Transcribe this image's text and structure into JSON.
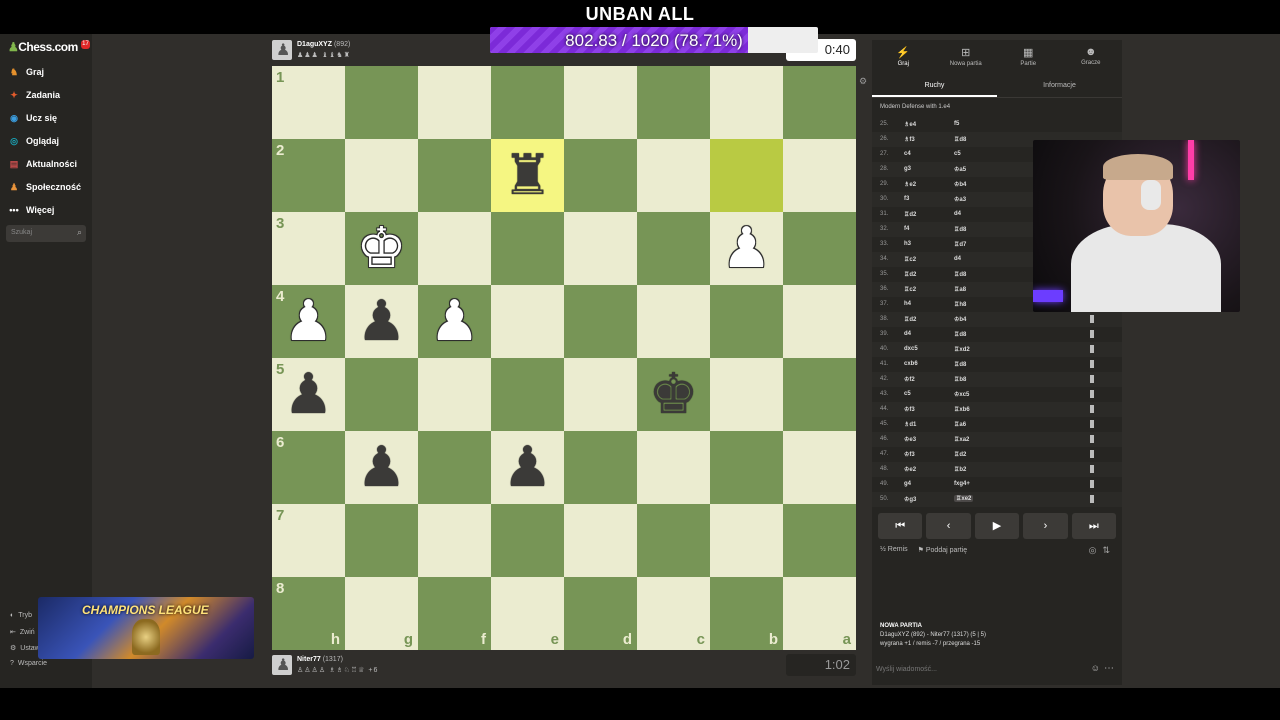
{
  "overlay": {
    "title": "UNBAN ALL",
    "goal_text": "802.83 / 1020 (78.71%)",
    "goal_progress": 0.7871,
    "accent": "#7c2ad8"
  },
  "sidebar": {
    "logo": "Chess.com",
    "notif_count": "17",
    "items": [
      {
        "label": "Graj",
        "icon": "play-icon",
        "color": "#e6912c"
      },
      {
        "label": "Zadania",
        "icon": "puzzle-icon",
        "color": "#e25b2c"
      },
      {
        "label": "Ucz się",
        "icon": "learn-icon",
        "color": "#3b9ee0"
      },
      {
        "label": "Oglądaj",
        "icon": "watch-icon",
        "color": "#1aa3b5"
      },
      {
        "label": "Aktualności",
        "icon": "news-icon",
        "color": "#c74d4d"
      },
      {
        "label": "Społeczność",
        "icon": "community-icon",
        "color": "#e8933b"
      },
      {
        "label": "Więcej",
        "icon": "more-icon",
        "color": "#ffffff"
      }
    ],
    "search_placeholder": "Szukaj",
    "bottom": [
      "Tryb",
      "Zwiń",
      "Ustaw",
      "Wsparcie"
    ]
  },
  "overlays": {
    "champions_label": "CHAMPIONS LEAGUE"
  },
  "top_player": {
    "name": "D1aguXYZ",
    "rating": "(892)",
    "captured": "♟♟♟ ♝♝♞♜",
    "clock": "0:40"
  },
  "bottom_player": {
    "name": "Niter77",
    "rating": "(1317)",
    "captured": "♙♙♙♙ ♗♗♘♖♕  +6",
    "clock": "1:02"
  },
  "board": {
    "ranks": [
      "1",
      "2",
      "3",
      "4",
      "5",
      "6",
      "7",
      "8"
    ],
    "files": [
      "h",
      "g",
      "f",
      "e",
      "d",
      "c",
      "b",
      "a"
    ],
    "highlight": [
      "2-3",
      "2-6"
    ],
    "pieces": [
      {
        "sq": "2-3",
        "glyph": "♜",
        "color": "black"
      },
      {
        "sq": "3-1",
        "glyph": "♚",
        "color": "white"
      },
      {
        "sq": "3-6",
        "glyph": "♟",
        "color": "white"
      },
      {
        "sq": "4-0",
        "glyph": "♟",
        "color": "white"
      },
      {
        "sq": "4-1",
        "glyph": "♟",
        "color": "black"
      },
      {
        "sq": "4-2",
        "glyph": "♟",
        "color": "white"
      },
      {
        "sq": "5-0",
        "glyph": "♟",
        "color": "black"
      },
      {
        "sq": "5-5",
        "glyph": "♚",
        "color": "black"
      },
      {
        "sq": "6-1",
        "glyph": "♟",
        "color": "black"
      },
      {
        "sq": "6-3",
        "glyph": "♟",
        "color": "black"
      }
    ]
  },
  "panel": {
    "tabs": [
      {
        "label": "Graj",
        "icon": "⚡",
        "active": true
      },
      {
        "label": "Nowa partia",
        "icon": "＋",
        "active": false
      },
      {
        "label": "Partie",
        "icon": "▦",
        "active": false
      },
      {
        "label": "Gracze",
        "icon": "👥",
        "active": false
      }
    ],
    "subtabs": [
      "Ruchy",
      "Informacje"
    ],
    "opening": "Modern Defense with 1.e4",
    "moves": [
      {
        "n": "25.",
        "w": "♗e4",
        "b": "f5"
      },
      {
        "n": "26.",
        "w": "♗f3",
        "b": "♖d8"
      },
      {
        "n": "27.",
        "w": "c4",
        "b": "c5"
      },
      {
        "n": "28.",
        "w": "g3",
        "b": "♔a5"
      },
      {
        "n": "29.",
        "w": "♗e2",
        "b": "♔b4"
      },
      {
        "n": "30.",
        "w": "f3",
        "b": "♔a3"
      },
      {
        "n": "31.",
        "w": "♖d2",
        "b": "d4"
      },
      {
        "n": "32.",
        "w": "f4",
        "b": "♖d8"
      },
      {
        "n": "33.",
        "w": "h3",
        "b": "♖d7"
      },
      {
        "n": "34.",
        "w": "♖c2",
        "b": "d4"
      },
      {
        "n": "35.",
        "w": "♖d2",
        "b": "♖d8"
      },
      {
        "n": "36.",
        "w": "♖c2",
        "b": "♖a8"
      },
      {
        "n": "37.",
        "w": "h4",
        "b": "♖h8"
      },
      {
        "n": "38.",
        "w": "♖d2",
        "b": "♔b4"
      },
      {
        "n": "39.",
        "w": "d4",
        "b": "♖d8"
      },
      {
        "n": "40.",
        "w": "dxc5",
        "b": "♖xd2"
      },
      {
        "n": "41.",
        "w": "cxb6",
        "b": "♖d8"
      },
      {
        "n": "42.",
        "w": "♔f2",
        "b": "♖b8"
      },
      {
        "n": "43.",
        "w": "c5",
        "b": "♔xc5"
      },
      {
        "n": "44.",
        "w": "♔f3",
        "b": "♖xb6"
      },
      {
        "n": "45.",
        "w": "♗d1",
        "b": "♖a6"
      },
      {
        "n": "46.",
        "w": "♔e3",
        "b": "♖xa2"
      },
      {
        "n": "47.",
        "w": "♔f3",
        "b": "♖d2"
      },
      {
        "n": "48.",
        "w": "♔e2",
        "b": "♖b2"
      },
      {
        "n": "49.",
        "w": "g4",
        "b": "fxg4+"
      },
      {
        "n": "50.",
        "w": "♔g3",
        "b": "♖xe2"
      }
    ],
    "nav": [
      "⏮",
      "‹",
      "▶",
      "›",
      "⏭"
    ],
    "draw_label": "Remis",
    "resign_label": "Poddaj partię",
    "newgame_title": "NOWA PARTIA",
    "newgame_players": "D1aguXYZ (892) - Niter77 (1317) (5 | 5)",
    "newgame_record": "wygrana +1 / remis -7 / przegrana -15",
    "chat_placeholder": "Wyślij wiadomość..."
  }
}
